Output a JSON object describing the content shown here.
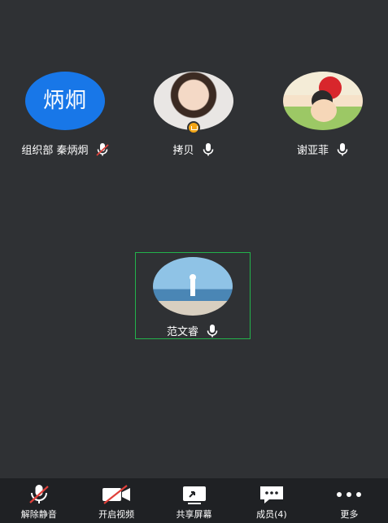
{
  "participants": [
    {
      "name": "组织部 秦炳炯",
      "avatar_text": "炳炯",
      "avatar_color": "#1877e8",
      "mic": "muted-icon"
    },
    {
      "name": "拷贝",
      "avatar_text": "",
      "mic": "mic-icon",
      "host": true
    },
    {
      "name": "谢亚菲",
      "avatar_text": "",
      "mic": "mic-icon"
    },
    {
      "name": "范文睿",
      "avatar_text": "",
      "mic": "mic-icon",
      "speaking": true
    }
  ],
  "toolbar": {
    "unmute_label": "解除静音",
    "video_label": "开启视频",
    "share_label": "共享屏幕",
    "members_label": "成员(4)",
    "more_label": "更多"
  },
  "colors": {
    "background": "#2f3134",
    "toolbar": "#1f2124",
    "active_border": "#23b24b",
    "mute_red": "#e0403a"
  }
}
